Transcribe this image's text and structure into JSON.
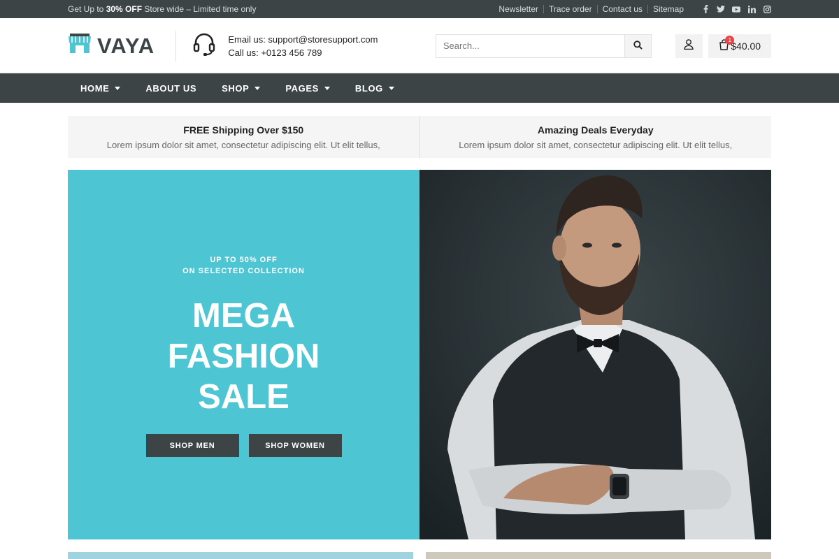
{
  "topbar": {
    "promo_prefix": "Get Up to ",
    "promo_bold": "30% OFF",
    "promo_suffix": " Store wide – Limited time only",
    "links": [
      "Newsletter",
      "Trace order",
      "Contact us",
      "Sitemap"
    ],
    "socials": [
      "facebook-icon",
      "twitter-icon",
      "youtube-icon",
      "linkedin-icon",
      "instagram-icon"
    ]
  },
  "header": {
    "logo_text": "VAYA",
    "email_label": "Email us: ",
    "email": "support@storesupport.com",
    "phone_label": "Call us: ",
    "phone": "+0123 456 789",
    "search_placeholder": "Search...",
    "cart_count": "1",
    "cart_total": "$40.00"
  },
  "nav": {
    "items": [
      {
        "label": "HOME",
        "dropdown": true
      },
      {
        "label": "ABOUT US",
        "dropdown": false
      },
      {
        "label": "SHOP",
        "dropdown": true
      },
      {
        "label": "PAGES",
        "dropdown": true
      },
      {
        "label": "BLOG",
        "dropdown": true
      }
    ]
  },
  "features": [
    {
      "title": "FREE Shipping Over $150",
      "text": "Lorem ipsum dolor sit amet, consectetur adipiscing elit. Ut elit tellus,"
    },
    {
      "title": "Amazing Deals Everyday",
      "text": "Lorem ipsum dolor sit amet, consectetur adipiscing elit. Ut elit tellus,"
    }
  ],
  "hero": {
    "kicker_line1": "UP TO 50% OFF",
    "kicker_line2": "ON SELECTED COLLECTION",
    "title_line1": "MEGA",
    "title_line2": "FASHION",
    "title_line3": "SALE",
    "btn_men": "SHOP MEN",
    "btn_women": "SHOP WOMEN"
  },
  "colors": {
    "dark": "#3d4446",
    "accent": "#4ec5d3",
    "badge": "#e64646"
  }
}
